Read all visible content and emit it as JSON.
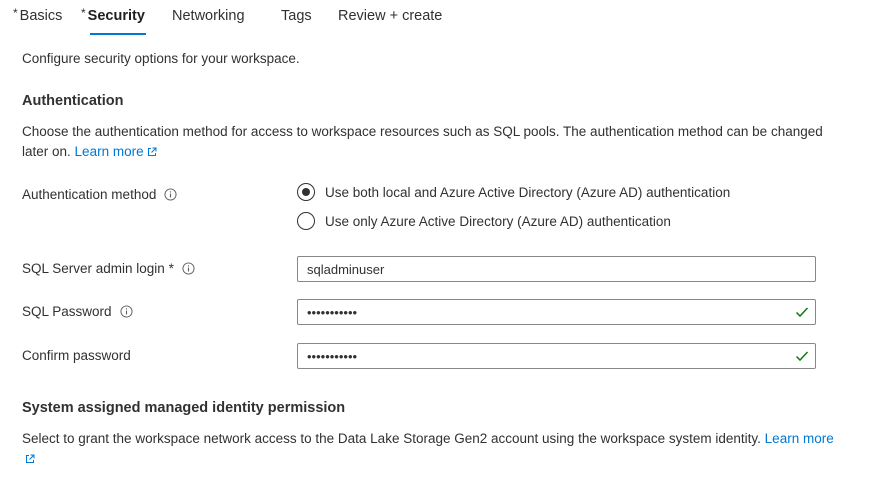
{
  "tabs": [
    {
      "label": "Basics",
      "required_marker": "*"
    },
    {
      "label": "Security",
      "required_marker": "*"
    },
    {
      "label": "Networking"
    },
    {
      "label": "Tags"
    },
    {
      "label": "Review + create"
    }
  ],
  "active_tab": "Security",
  "intro": "Configure security options for your workspace.",
  "authentication": {
    "heading": "Authentication",
    "description": "Choose the authentication method for access to workspace resources such as SQL pools. The authentication method can be changed later on.",
    "learn_more": "Learn more",
    "method_label": "Authentication method",
    "options": [
      {
        "label": "Use both local and Azure Active Directory (Azure AD) authentication",
        "selected": true
      },
      {
        "label": "Use only Azure Active Directory (Azure AD) authentication",
        "selected": false
      }
    ]
  },
  "fields": {
    "admin_login": {
      "label": "SQL Server admin login",
      "required_marker": "*",
      "value": "sqladminuser"
    },
    "password": {
      "label": "SQL Password",
      "value": "•••••••••••",
      "valid": true
    },
    "confirm_password": {
      "label": "Confirm password",
      "value": "•••••••••••",
      "valid": true
    }
  },
  "managed_identity": {
    "heading": "System assigned managed identity permission",
    "description": "Select to grant the workspace network access to the Data Lake Storage Gen2 account using the workspace system identity.",
    "learn_more": "Learn more"
  },
  "colors": {
    "accent": "#0078d4",
    "valid_check": "#107c10",
    "text": "#323130",
    "border": "#8a8886"
  },
  "icons": {
    "info": "info-icon",
    "external_link": "external-link-icon",
    "check": "checkmark-icon"
  }
}
